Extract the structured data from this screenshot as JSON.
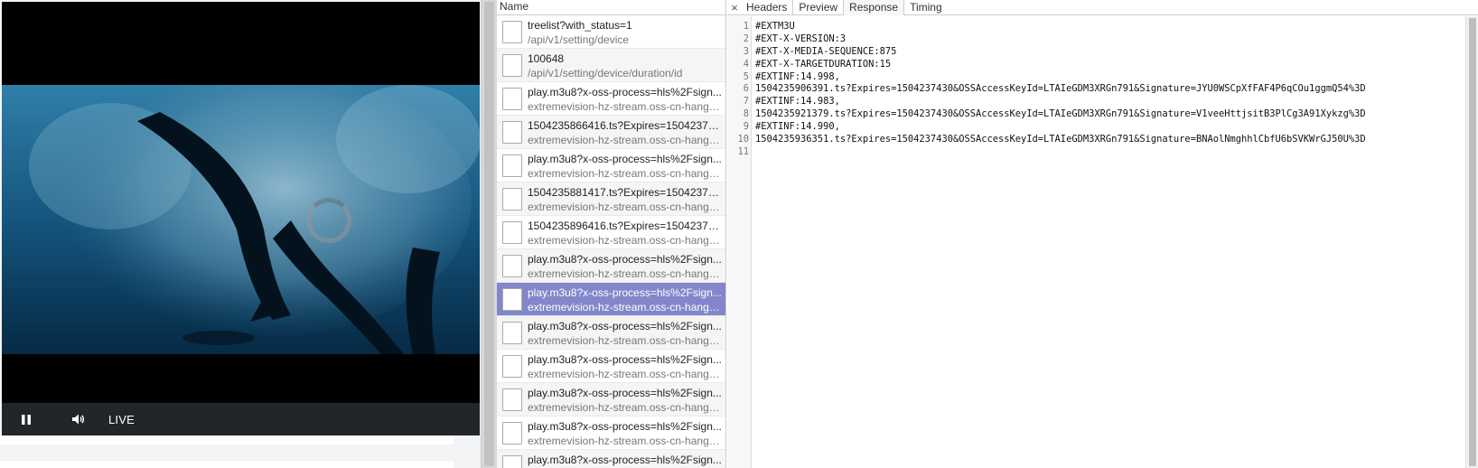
{
  "player": {
    "live_label": "LIVE",
    "icons": {
      "pause": "pause-icon",
      "volume": "volume-icon",
      "loading": "loading-spinner-icon"
    }
  },
  "network_list": {
    "header": "Name",
    "selected_index": 8,
    "requests": [
      {
        "name": "treelist?with_status=1",
        "path": "/api/v1/setting/device"
      },
      {
        "name": "100648",
        "path": "/api/v1/setting/device/duration/id"
      },
      {
        "name": "play.m3u8?x-oss-process=hls%2Fsign...",
        "path": "extremevision-hz-stream.oss-cn-hangz..."
      },
      {
        "name": "1504235866416.ts?Expires=150423743...",
        "path": "extremevision-hz-stream.oss-cn-hangz..."
      },
      {
        "name": "play.m3u8?x-oss-process=hls%2Fsign...",
        "path": "extremevision-hz-stream.oss-cn-hangz..."
      },
      {
        "name": "1504235881417.ts?Expires=150423743...",
        "path": "extremevision-hz-stream.oss-cn-hangz..."
      },
      {
        "name": "1504235896416.ts?Expires=150423743...",
        "path": "extremevision-hz-stream.oss-cn-hangz..."
      },
      {
        "name": "play.m3u8?x-oss-process=hls%2Fsign...",
        "path": "extremevision-hz-stream.oss-cn-hangz..."
      },
      {
        "name": "play.m3u8?x-oss-process=hls%2Fsign...",
        "path": "extremevision-hz-stream.oss-cn-hangz..."
      },
      {
        "name": "play.m3u8?x-oss-process=hls%2Fsign...",
        "path": "extremevision-hz-stream.oss-cn-hangz..."
      },
      {
        "name": "play.m3u8?x-oss-process=hls%2Fsign...",
        "path": "extremevision-hz-stream.oss-cn-hangz..."
      },
      {
        "name": "play.m3u8?x-oss-process=hls%2Fsign...",
        "path": "extremevision-hz-stream.oss-cn-hangz..."
      },
      {
        "name": "play.m3u8?x-oss-process=hls%2Fsign...",
        "path": "extremevision-hz-stream.oss-cn-hangz..."
      },
      {
        "name": "play.m3u8?x-oss-process=hls%2Fsign...",
        "path": ""
      }
    ]
  },
  "detail": {
    "close_label": "×",
    "tabs": [
      "Headers",
      "Preview",
      "Response",
      "Timing"
    ],
    "active_tab": "Response",
    "lines": [
      "#EXTM3U",
      "#EXT-X-VERSION:3",
      "#EXT-X-MEDIA-SEQUENCE:875",
      "#EXT-X-TARGETDURATION:15",
      "#EXTINF:14.998,",
      "1504235906391.ts?Expires=1504237430&OSSAccessKeyId=LTAIeGDM3XRGn791&Signature=JYU0WSCpXfFAF4P6qCOu1ggmQ54%3D",
      "#EXTINF:14.983,",
      "1504235921379.ts?Expires=1504237430&OSSAccessKeyId=LTAIeGDM3XRGn791&Signature=V1veeHttjsitB3PlCg3A91Xykzg%3D",
      "#EXTINF:14.990,",
      "1504235936351.ts?Expires=1504237430&OSSAccessKeyId=LTAIeGDM3XRGn791&Signature=BNAolNmghhlCbfU6bSVKWrGJ50U%3D",
      ""
    ]
  }
}
